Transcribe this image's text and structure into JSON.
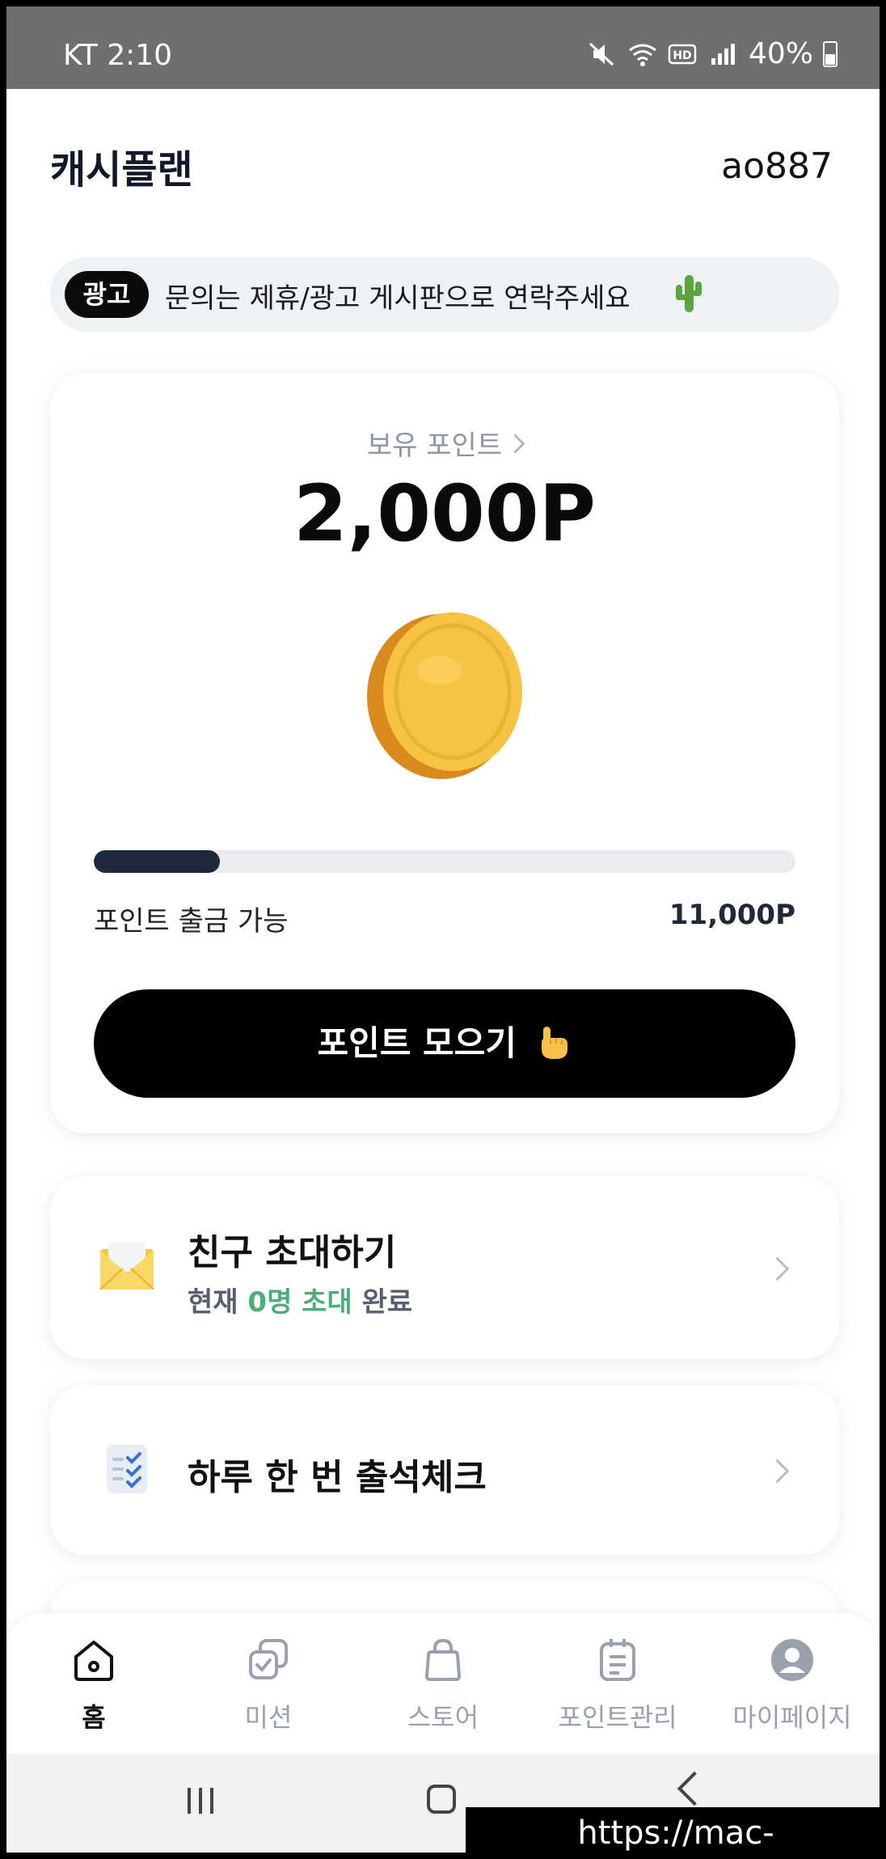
{
  "status_bar": {
    "carrier_time": "KT 2:10",
    "battery": "40%",
    "icons": [
      "mute-icon",
      "wifi-icon",
      "hd-icon",
      "signal-icon",
      "battery-icon"
    ]
  },
  "header": {
    "title": "캐시플랜",
    "username": "ao887"
  },
  "ad_banner": {
    "badge": "광고",
    "text": "문의는 제휴/광고 게시판으로 연락주세요",
    "icon": "cactus-icon"
  },
  "points": {
    "label": "보유 포인트",
    "value": "2,000P",
    "progress_fraction": 0.18,
    "withdraw_label": "포인트 출금 가능",
    "withdraw_value": "11,000P",
    "collect_button": "포인트 모으기",
    "colors": {
      "progress": "#1e293b",
      "button": "#000000"
    }
  },
  "invite": {
    "title": "친구 초대하기",
    "sub_prefix": "현재",
    "sub_highlight": "0명 초대",
    "sub_suffix": "완료",
    "icon": "envelope-icon",
    "highlight_color": "#4caf7a"
  },
  "attendance": {
    "title": "하루 한 번 출석체크",
    "icon": "checklist-icon"
  },
  "bottom_nav": {
    "items": [
      {
        "label": "홈",
        "icon": "home-icon",
        "active": true
      },
      {
        "label": "미션",
        "icon": "mission-icon",
        "active": false
      },
      {
        "label": "스토어",
        "icon": "shopping-bag-icon",
        "active": false
      },
      {
        "label": "포인트관리",
        "icon": "clipboard-icon",
        "active": false
      },
      {
        "label": "마이페이지",
        "icon": "profile-icon",
        "active": false
      }
    ]
  },
  "watermark": "https://mac-os.tistory.com"
}
